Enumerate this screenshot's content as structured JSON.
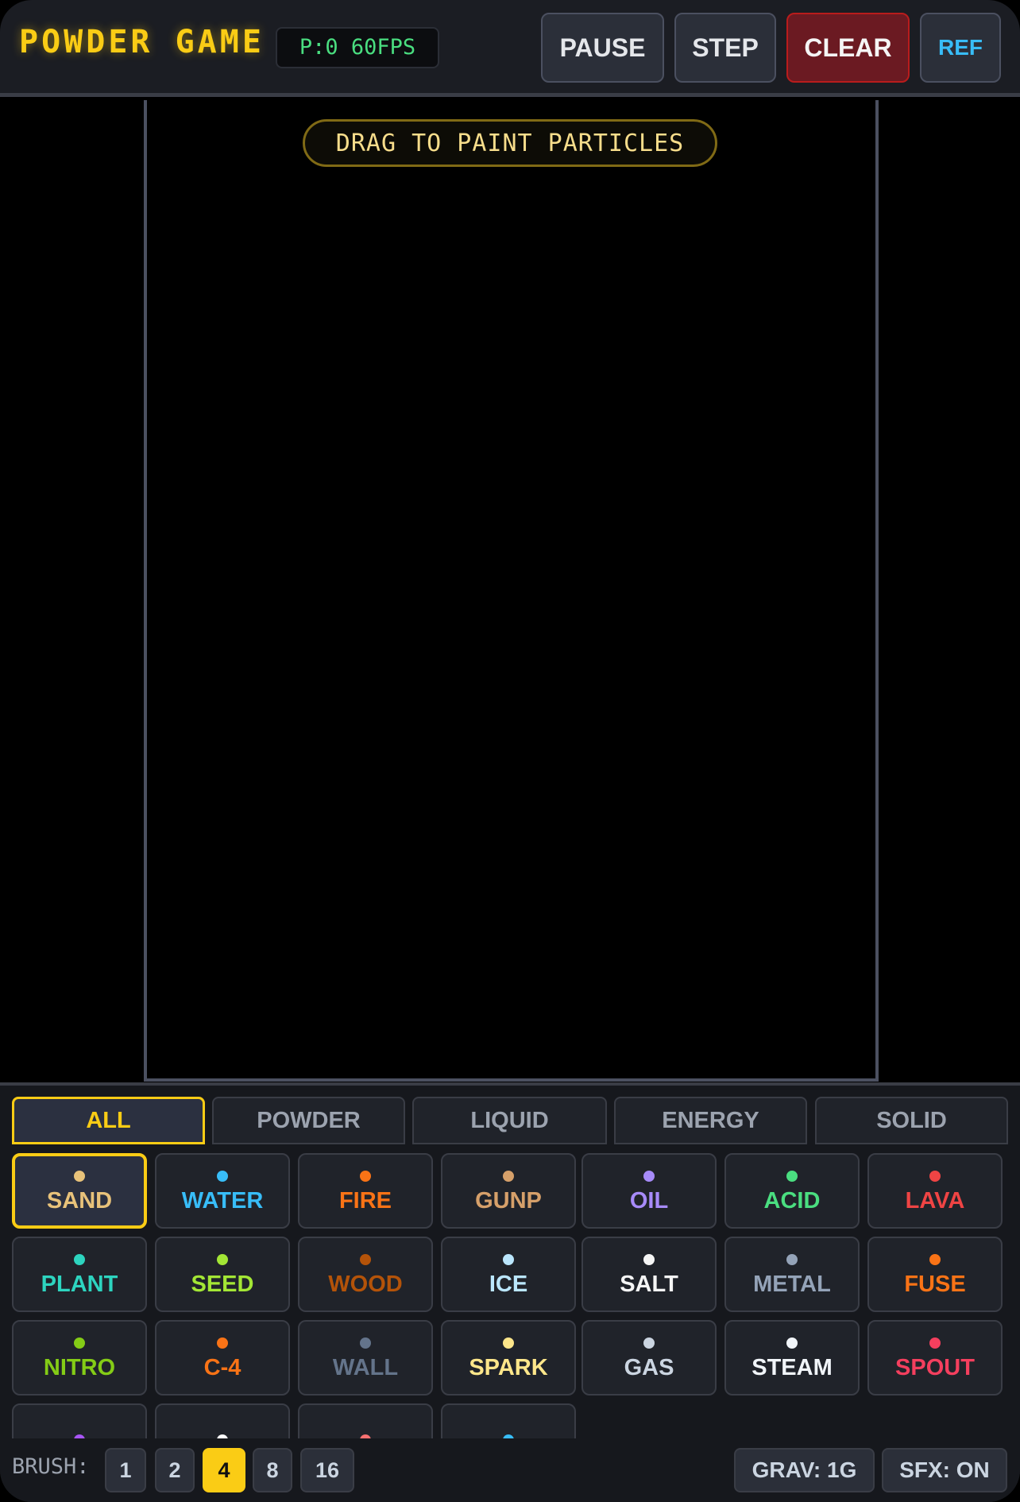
{
  "header": {
    "title": "POWDER GAME",
    "stats": "P:0 60FPS",
    "pause_label": "PAUSE",
    "step_label": "STEP",
    "clear_label": "CLEAR",
    "ref_label": "REF"
  },
  "canvas": {
    "hint": "DRAG TO PAINT PARTICLES"
  },
  "tabs": [
    {
      "label": "ALL",
      "active": true
    },
    {
      "label": "POWDER"
    },
    {
      "label": "LIQUID"
    },
    {
      "label": "ENERGY"
    },
    {
      "label": "SOLID"
    }
  ],
  "elements": [
    {
      "label": "SAND",
      "color": "#e8c27a",
      "selected": true
    },
    {
      "label": "WATER",
      "color": "#38bdf8"
    },
    {
      "label": "FIRE",
      "color": "#f97316"
    },
    {
      "label": "GUNP",
      "color": "#d6a06a"
    },
    {
      "label": "OIL",
      "color": "#a78bfa"
    },
    {
      "label": "ACID",
      "color": "#4ade80"
    },
    {
      "label": "LAVA",
      "color": "#ef4444"
    },
    {
      "label": "PLANT",
      "color": "#2dd4bf"
    },
    {
      "label": "SEED",
      "color": "#a3e635"
    },
    {
      "label": "WOOD",
      "color": "#b45309"
    },
    {
      "label": "ICE",
      "color": "#bae6fd"
    },
    {
      "label": "SALT",
      "color": "#f5f5f5"
    },
    {
      "label": "METAL",
      "color": "#94a3b8"
    },
    {
      "label": "FUSE",
      "color": "#f97316"
    },
    {
      "label": "NITRO",
      "color": "#84cc16"
    },
    {
      "label": "C-4",
      "color": "#f97316"
    },
    {
      "label": "WALL",
      "color": "#64748b"
    },
    {
      "label": "SPARK",
      "color": "#fde68a"
    },
    {
      "label": "GAS",
      "color": "#cbd5e1"
    },
    {
      "label": "STEAM",
      "color": "#f1f5f9"
    },
    {
      "label": "SPOUT",
      "color": "#f43f5e"
    },
    {
      "label": "",
      "color": "#a855f7"
    },
    {
      "label": "",
      "color": "#ffffff"
    },
    {
      "label": "",
      "color": "#f87171"
    },
    {
      "label": "",
      "color": "#38bdf8"
    }
  ],
  "footer": {
    "brush_label": "BRUSH:",
    "brush_sizes": [
      "1",
      "2",
      "4",
      "8",
      "16"
    ],
    "active_brush": "4",
    "gravity_label": "GRAV: 1G",
    "sfx_label": "SFX: ON"
  }
}
